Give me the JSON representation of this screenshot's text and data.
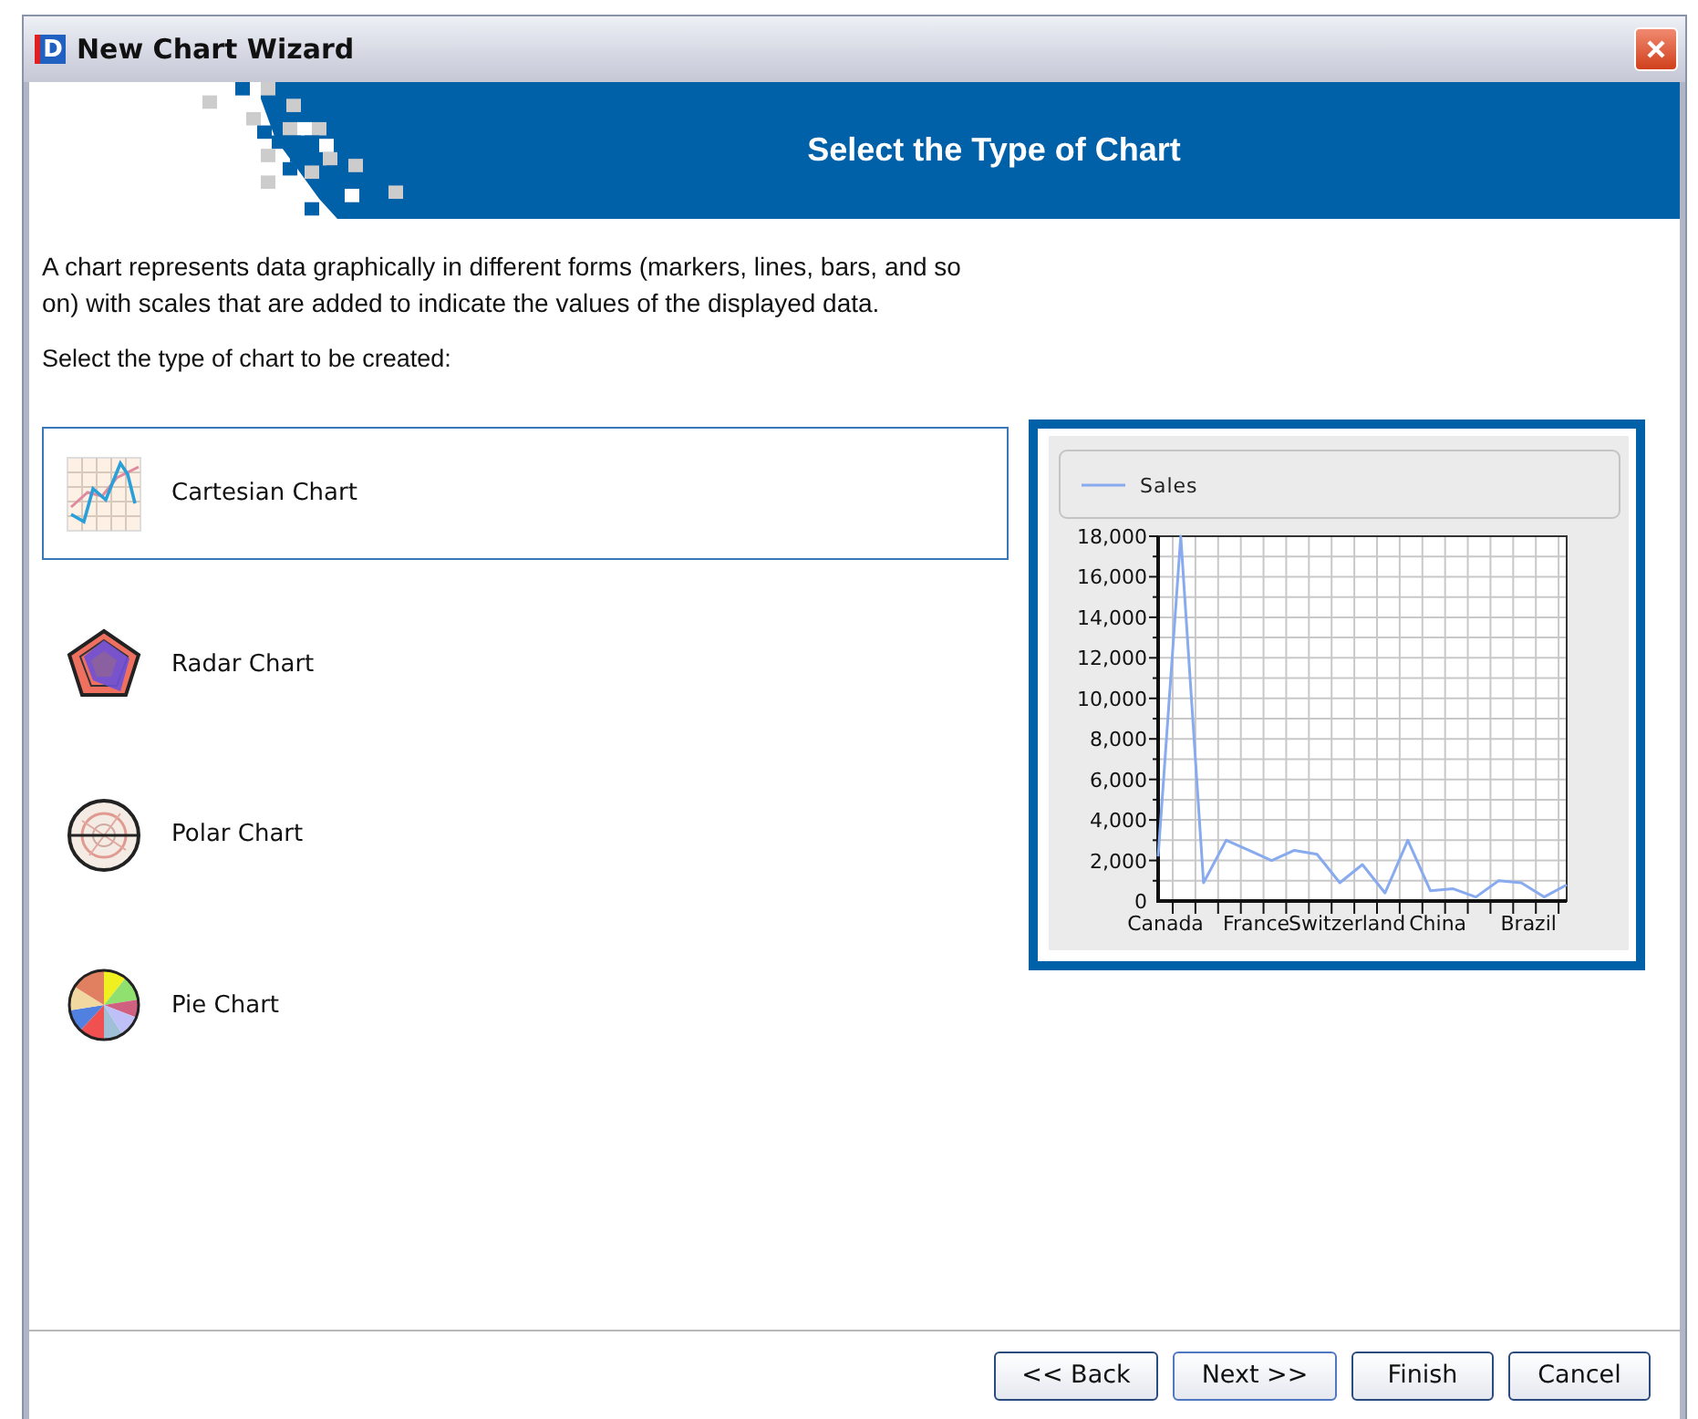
{
  "window": {
    "icon_letter": "D",
    "title": "New Chart Wizard"
  },
  "header": {
    "title": "Select the Type of Chart"
  },
  "description": "A chart represents data graphically in different forms (markers, lines, bars, and so on) with scales that are added to indicate the values of the displayed data.",
  "prompt": "Select the type of chart to be created:",
  "chart_types": [
    {
      "kind": "cartesian",
      "label": "Cartesian Chart",
      "selected": true
    },
    {
      "kind": "radar",
      "label": "Radar Chart",
      "selected": false
    },
    {
      "kind": "polar",
      "label": "Polar Chart",
      "selected": false
    },
    {
      "kind": "pie",
      "label": "Pie Chart",
      "selected": false
    }
  ],
  "preview": {
    "chart_data": {
      "type": "line",
      "categories": [
        "Canada",
        null,
        null,
        null,
        "France",
        null,
        null,
        null,
        "Switzerland",
        null,
        null,
        null,
        "China",
        null,
        null,
        null,
        "Brazil",
        null,
        null
      ],
      "series": [
        {
          "name": "Sales",
          "color": "#88aaee",
          "values": [
            2200,
            18000,
            900,
            3000,
            2500,
            2000,
            2500,
            2300,
            900,
            1800,
            400,
            3000,
            500,
            600,
            200,
            1000,
            900,
            200,
            800
          ]
        }
      ],
      "ylim": [
        0,
        18000
      ],
      "grid": true,
      "yticks": [
        {
          "value": 0,
          "label": "0"
        },
        {
          "value": 2000,
          "label": "2,000"
        },
        {
          "value": 4000,
          "label": "4,000"
        },
        {
          "value": 6000,
          "label": "6,000"
        },
        {
          "value": 8000,
          "label": "8,000"
        },
        {
          "value": 10000,
          "label": "10,000"
        },
        {
          "value": 12000,
          "label": "12,000"
        },
        {
          "value": 14000,
          "label": "14,000"
        },
        {
          "value": 16000,
          "label": "16,000"
        },
        {
          "value": 18000,
          "label": "18,000"
        }
      ]
    }
  },
  "buttons": [
    "<< Back",
    "Next >>",
    "Finish",
    "Cancel"
  ]
}
